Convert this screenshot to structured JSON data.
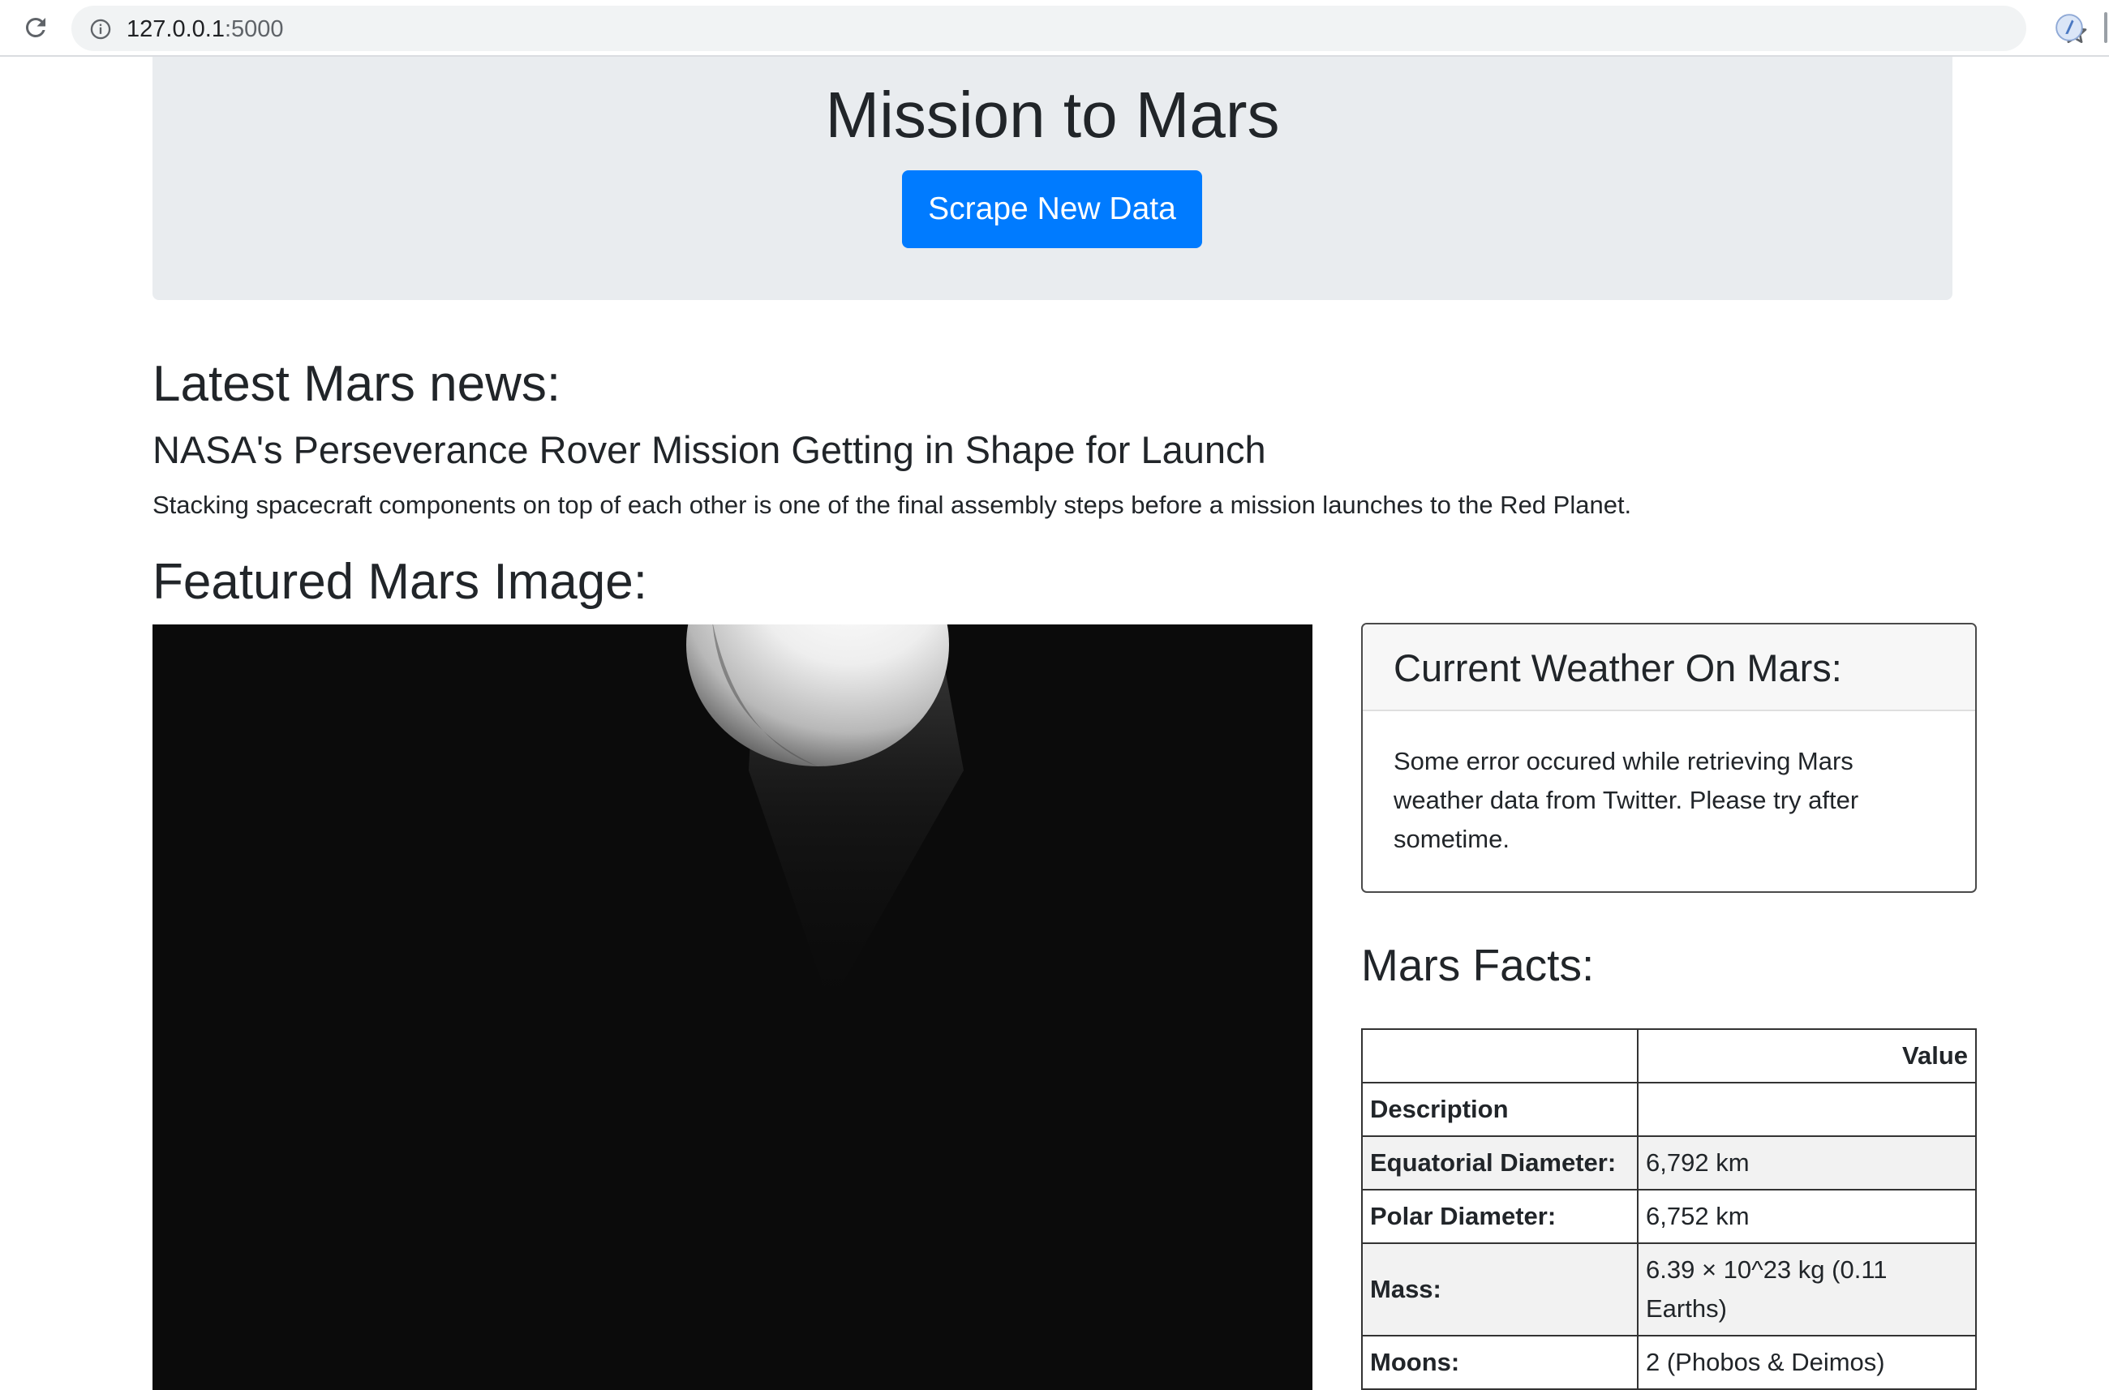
{
  "browser": {
    "url_host": "127.0.0.1",
    "url_port": ":5000"
  },
  "header": {
    "title": "Mission to Mars",
    "scrape_button_label": "Scrape New Data"
  },
  "news": {
    "heading": "Latest Mars news:",
    "title": "NASA's Perseverance Rover Mission Getting in Shape for Launch",
    "teaser": "Stacking spacecraft components on top of each other is one of the final assembly steps before a mission launches to the Red Planet."
  },
  "featured": {
    "heading": "Featured Mars Image:"
  },
  "weather": {
    "title": "Current Weather On Mars:",
    "message": "Some error occured while retrieving Mars weather data from Twitter. Please try after sometime."
  },
  "facts": {
    "heading": "Mars Facts:",
    "columns": [
      "",
      "Value"
    ],
    "index_label": "Description",
    "rows": [
      {
        "label": "Equatorial Diameter:",
        "value": "6,792 km"
      },
      {
        "label": "Polar Diameter:",
        "value": "6,752 km"
      },
      {
        "label": "Mass:",
        "value": "6.39 × 10^23 kg (0.11 Earths)"
      },
      {
        "label": "Moons:",
        "value": "2 (Phobos & Deimos)"
      }
    ]
  },
  "colors": {
    "primary": "#007bff",
    "jumbotron": "#e9ecef",
    "text": "#212529"
  }
}
